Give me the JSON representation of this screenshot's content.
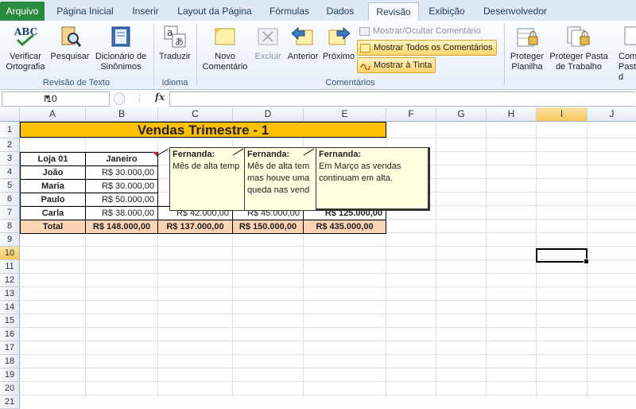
{
  "tabs": [
    "Arquivo",
    "Página Inicial",
    "Inserir",
    "Layout da Página",
    "Fórmulas",
    "Dados",
    "Revisão",
    "Exibição",
    "Desenvolvedor"
  ],
  "active_tab": "Revisão",
  "groups": {
    "revisao_texto": {
      "label": "Revisão de Texto",
      "buttons": [
        "Verificar\nOrtografia",
        "Pesquisar",
        "Dicionário de\nSinônimos"
      ]
    },
    "idioma": {
      "label": "Idioma",
      "buttons": [
        "Traduzir"
      ]
    },
    "comentarios": {
      "label": "Comentários",
      "buttons": [
        "Novo\nComentário",
        "Excluir",
        "Anterior",
        "Próximo"
      ],
      "small": [
        "Mostrar/Ocultar Comentário",
        "Mostrar Todos os Comentários",
        "Mostrar à Tinta"
      ]
    },
    "alteracoes": {
      "buttons": [
        "Proteger\nPlanilha",
        "Proteger Pasta\nde Trabalho",
        "Com\nPasta d"
      ]
    }
  },
  "name_box": "I10",
  "fx": "fx",
  "columns": [
    "A",
    "B",
    "C",
    "D",
    "E",
    "F",
    "G",
    "H",
    "I",
    "J"
  ],
  "rows": [
    "1",
    "2",
    "3",
    "4",
    "5",
    "6",
    "7",
    "8",
    "9",
    "10",
    "11",
    "12",
    "13",
    "14",
    "15",
    "16",
    "17",
    "18",
    "19",
    "20",
    "21"
  ],
  "sheet": {
    "title": "Vendas Trimestre - 1",
    "header": [
      "Loja 01",
      "Janeiro"
    ],
    "stores": [
      {
        "name": "João",
        "jan": "R$ 30.000,00"
      },
      {
        "name": "Maria",
        "jan": "R$ 30.000,00"
      },
      {
        "name": "Paulo",
        "jan": "R$ 50.000,00"
      },
      {
        "name": "Carla",
        "jan": "R$ 38.000,00",
        "feb": "R$ 42.000,00",
        "mar": "R$ 45.000,00",
        "tot": "R$ 125.000,00"
      }
    ],
    "total": {
      "label": "Total",
      "jan": "R$ 148.000,00",
      "feb": "R$ 137.000,00",
      "mar": "R$ 150.000,00",
      "tot": "R$ 435.000,00"
    }
  },
  "comments": [
    {
      "author": "Fernanda:",
      "text": "Mês de alta temp"
    },
    {
      "author": "Fernanda:",
      "text": "Mês de alta tem\nmas houve uma\nqueda nas vend"
    },
    {
      "author": "Fernanda:",
      "text": "Em Março as vendas\ncontinuam em alta."
    }
  ],
  "colors": {
    "file_tab": "#2a8a3e",
    "title_fill": "#ffc000",
    "total_fill": "#fbd4b4",
    "comment_fill": "#ffffe1"
  }
}
